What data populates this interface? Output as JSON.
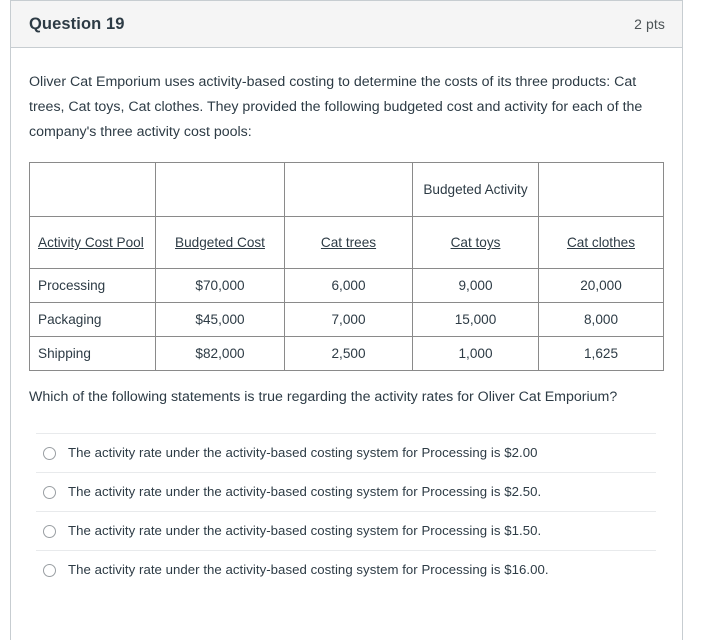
{
  "header": {
    "title": "Question 19",
    "points": "2 pts"
  },
  "prompt": "Oliver Cat Emporium uses activity-based costing to determine the costs of its three products: Cat trees, Cat toys, Cat clothes. They provided the following budgeted cost and activity for each of the company's three activity cost pools:",
  "table": {
    "group_header": {
      "col1": "",
      "col2": "",
      "col3": "",
      "budgeted_activity": "Budgeted Activity",
      "col5": ""
    },
    "columns": [
      "Activity Cost Pool",
      "Budgeted Cost",
      "Cat trees",
      "Cat toys",
      "Cat clothes"
    ],
    "rows": [
      {
        "pool": "Processing",
        "budgeted_cost": "$70,000",
        "cat_trees": "6,000",
        "cat_toys": "9,000",
        "cat_clothes": "20,000"
      },
      {
        "pool": "Packaging",
        "budgeted_cost": "$45,000",
        "cat_trees": "7,000",
        "cat_toys": "15,000",
        "cat_clothes": "8,000"
      },
      {
        "pool": "Shipping",
        "budgeted_cost": "$82,000",
        "cat_trees": "2,500",
        "cat_toys": "1,000",
        "cat_clothes": "1,625"
      }
    ]
  },
  "question": "Which of the following statements is true regarding the activity rates for Oliver Cat Emporium?",
  "answers": [
    {
      "text": "The activity rate under the activity-based costing system for Processing is $2.00"
    },
    {
      "text": "The activity rate under the activity-based costing system for Processing is $2.50."
    },
    {
      "text": "The activity rate under the activity-based costing system for Processing is $1.50."
    },
    {
      "text": "The activity rate under the activity-based costing system for Processing is $16.00."
    }
  ]
}
